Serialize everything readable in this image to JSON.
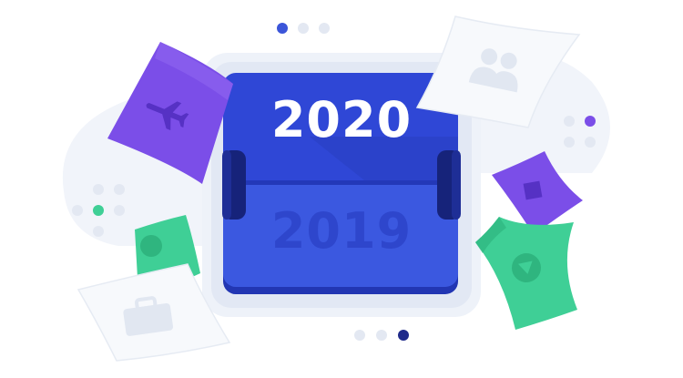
{
  "calendar": {
    "top_year": "2020",
    "bottom_year": "2019"
  },
  "colors": {
    "background": "#ffffff",
    "frame_light": "#eef2f9",
    "frame_mid": "#dfe6f2",
    "panel_blue": "#2f47d6",
    "panel_blue_light": "#3b58e0",
    "panel_edge": "#2236b3",
    "knob_navy": "#16237a",
    "top_year_text": "#ffffff",
    "bottom_year_text": "#2e46cc",
    "purple": "#7b4ee8",
    "green": "#3fcf96",
    "paper": "#f7f9fc",
    "paper_icon": "#e6ebf3",
    "dot_active": "#3b55d9",
    "dot_inactive": "#e3e8f2"
  },
  "icons": [
    "airplane-icon",
    "people-icon",
    "square-icon",
    "play-icon",
    "circle-icon",
    "briefcase-icon"
  ]
}
